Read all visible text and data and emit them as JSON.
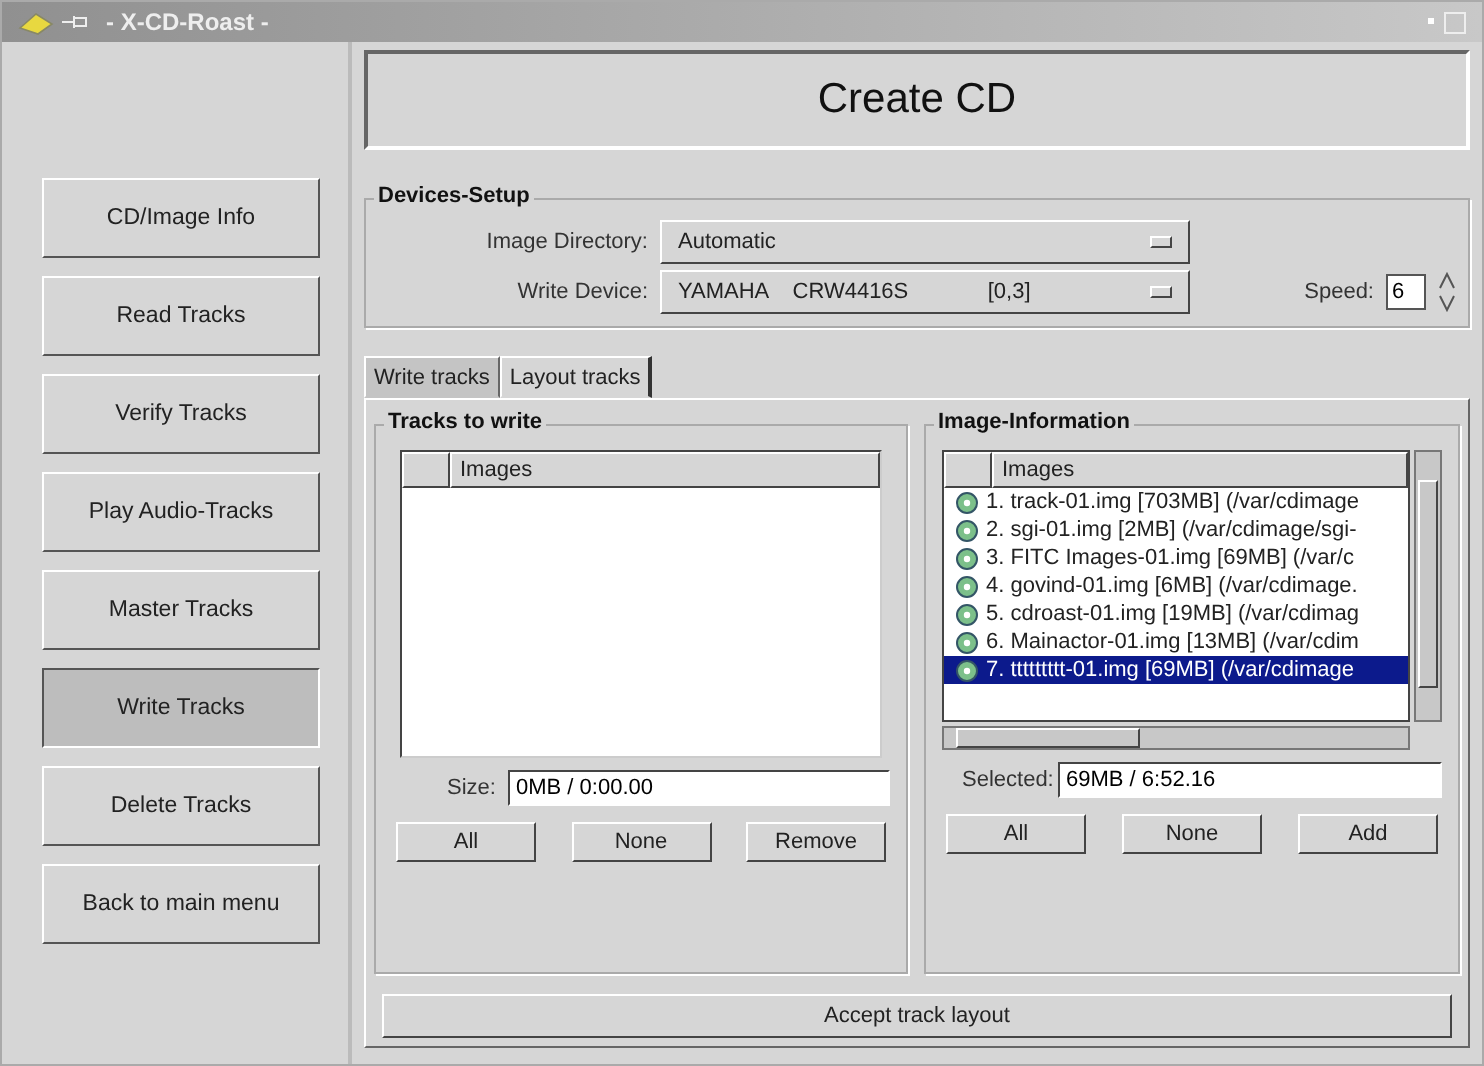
{
  "window": {
    "title": "- X-CD-Roast -"
  },
  "sidebar": {
    "items": [
      {
        "label": "CD/Image Info",
        "selected": false
      },
      {
        "label": "Read Tracks",
        "selected": false
      },
      {
        "label": "Verify Tracks",
        "selected": false
      },
      {
        "label": "Play Audio-Tracks",
        "selected": false
      },
      {
        "label": "Master Tracks",
        "selected": false
      },
      {
        "label": "Write Tracks",
        "selected": true
      },
      {
        "label": "Delete Tracks",
        "selected": false
      },
      {
        "label": "Back to main menu",
        "selected": false
      }
    ]
  },
  "heading": "Create CD",
  "devices_setup": {
    "title": "Devices-Setup",
    "image_directory": {
      "label": "Image Directory:",
      "value": "Automatic"
    },
    "write_device": {
      "label": "Write Device:",
      "value": "YAMAHA    CRW4416S             [0,3]"
    },
    "speed": {
      "label": "Speed:",
      "value": "6"
    }
  },
  "tabs": [
    {
      "label": "Write tracks",
      "selected": false
    },
    {
      "label": "Layout tracks",
      "selected": true
    }
  ],
  "tracks_to_write": {
    "title": "Tracks to write",
    "column": "Images",
    "size_label": "Size:",
    "size_value": "0MB / 0:00.00",
    "buttons": [
      "All",
      "None",
      "Remove"
    ]
  },
  "image_information": {
    "title": "Image-Information",
    "column": "Images",
    "rows": [
      {
        "label": "1. track-01.img [703MB] (/var/cdimage",
        "selected": false
      },
      {
        "label": "2. sgi-01.img [2MB] (/var/cdimage/sgi-",
        "selected": false
      },
      {
        "label": "3. FITC Images-01.img [69MB] (/var/c",
        "selected": false
      },
      {
        "label": "4. govind-01.img [6MB] (/var/cdimage.",
        "selected": false
      },
      {
        "label": "5. cdroast-01.img [19MB] (/var/cdimag",
        "selected": false
      },
      {
        "label": "6. Mainactor-01.img [13MB] (/var/cdim",
        "selected": false
      },
      {
        "label": "7. ttttttttt-01.img [69MB] (/var/cdimage",
        "selected": true
      }
    ],
    "selected_label": "Selected:",
    "selected_value": "69MB / 6:52.16",
    "buttons": [
      "All",
      "None",
      "Add"
    ]
  },
  "accept_button": "Accept track layout"
}
